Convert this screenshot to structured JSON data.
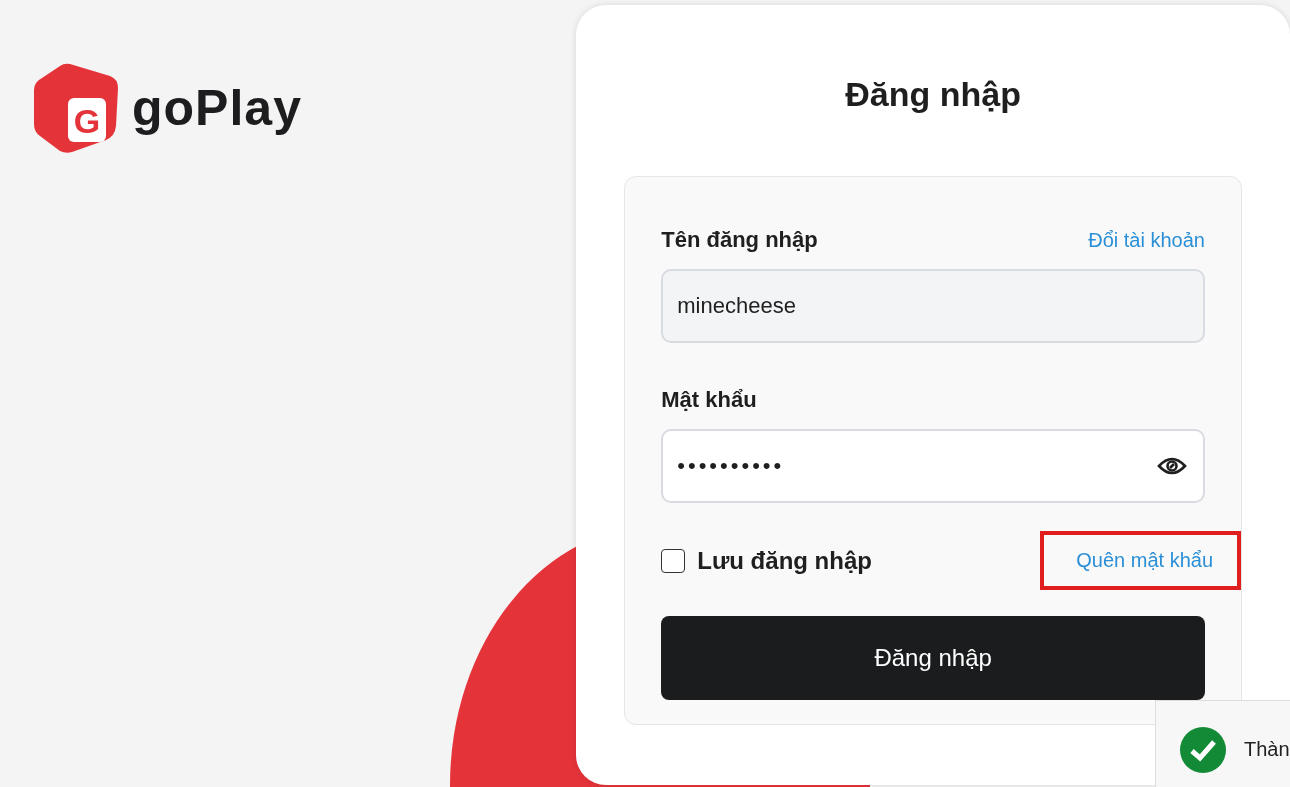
{
  "brand": {
    "name": "goPlay",
    "mark": "G"
  },
  "login": {
    "title": "Đăng nhập",
    "username": {
      "label": "Tên đăng nhập",
      "link": "Đổi tài khoản",
      "value": "minecheese"
    },
    "password": {
      "label": "Mật khẩu",
      "value": "••••••••••"
    },
    "remember": {
      "label": "Lưu đăng nhập",
      "checked": false
    },
    "forgot": {
      "label": "Quên mật khẩu",
      "highlighted": true
    },
    "submit": "Đăng nhập"
  },
  "toast": {
    "text": "Thàn"
  }
}
